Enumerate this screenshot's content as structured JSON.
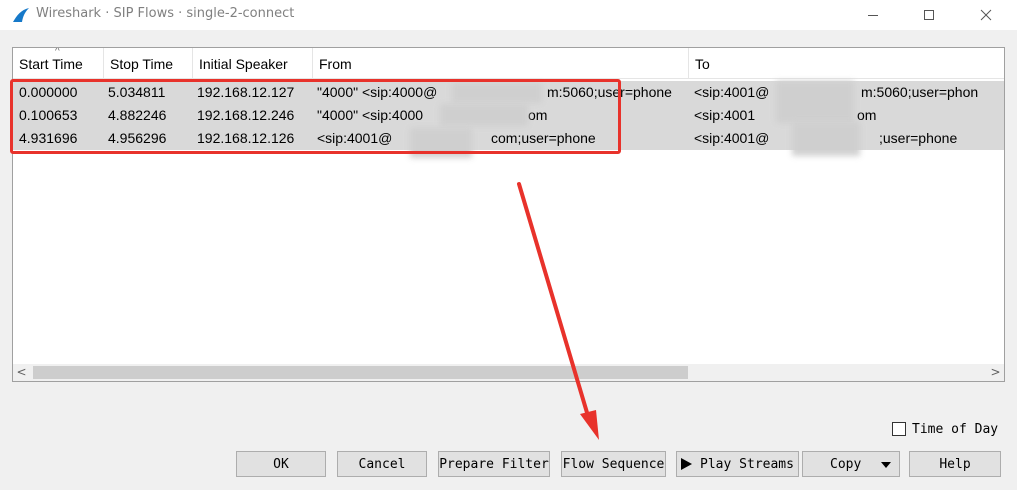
{
  "window": {
    "title": "Wireshark · SIP Flows · single-2-connect"
  },
  "table": {
    "columns": [
      "Start Time",
      "Stop Time",
      "Initial Speaker",
      "From",
      "To"
    ],
    "rows": [
      [
        "0.000000",
        "5.034811",
        "192.168.12.127",
        "\"4000\" <sip:4000@",
        "m:5060;user=phone",
        "<sip:4001@",
        "m:5060;user=phon"
      ],
      [
        "0.100653",
        "4.882246",
        "192.168.12.246",
        "\"4000\" <sip:4000",
        "om",
        "<sip:4001",
        "om"
      ],
      [
        "4.931696",
        "4.956296",
        "192.168.12.126",
        "<sip:4001@",
        "com;user=phone",
        "<sip:4001@",
        ";user=phone"
      ]
    ]
  },
  "controls": {
    "time_of_day_label": "Time of Day",
    "time_of_day_checked": false,
    "buttons": {
      "ok": "OK",
      "cancel": "Cancel",
      "prepare_filter": "Prepare Filter",
      "flow_sequence": "Flow Sequence",
      "play_streams": "Play Streams",
      "copy": "Copy",
      "help": "Help"
    }
  },
  "icons": {
    "app": "wireshark-fin-icon",
    "minimize": "minimize-icon",
    "maximize": "maximize-icon",
    "close": "close-icon",
    "scroll_left": "chevron-left-icon",
    "scroll_right": "chevron-right-icon",
    "play": "play-icon",
    "dropdown": "caret-down-icon"
  },
  "colors": {
    "annotation_red": "#e8322b",
    "row_selected": "#d9d9d9",
    "wireshark_blue": "#1679c9"
  }
}
